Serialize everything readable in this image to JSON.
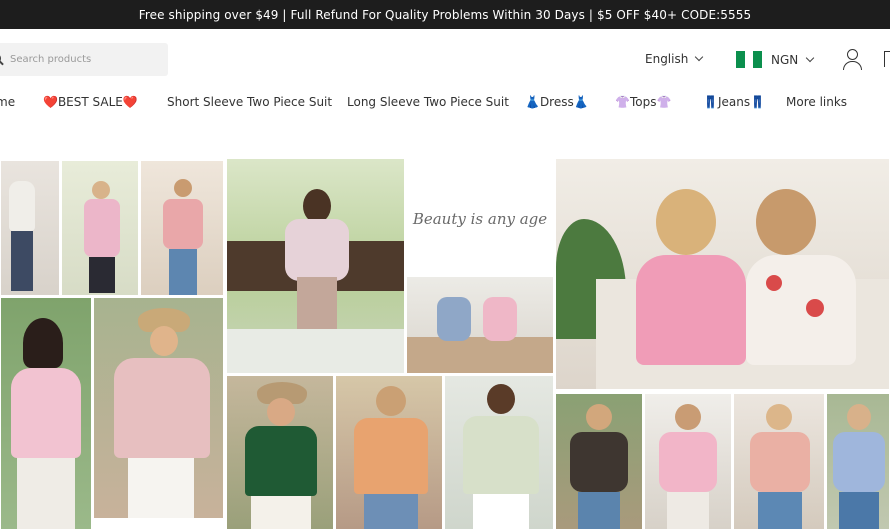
{
  "announcement": "Free shipping over $49 | Full Refund For Quality Problems Within 30 Days | $5 OFF $40+ CODE:5555",
  "search": {
    "placeholder": "Search products"
  },
  "language": "English",
  "currency": {
    "code": "NGN",
    "flag_colors": [
      "#0b8f4d",
      "#ffffff",
      "#0b8f4d"
    ]
  },
  "nav": {
    "items": [
      {
        "label": "me"
      },
      {
        "label": "❤️BEST SALE❤️"
      },
      {
        "label": "Short Sleeve Two Piece Suit"
      },
      {
        "label": "Long Sleeve Two Piece Suit"
      },
      {
        "label": "👗Dress👗"
      },
      {
        "label": "👚Tops👚"
      },
      {
        "label": "👖Jeans👖"
      },
      {
        "label": "More links"
      }
    ]
  },
  "banner": {
    "caption": "Beauty is any age"
  }
}
